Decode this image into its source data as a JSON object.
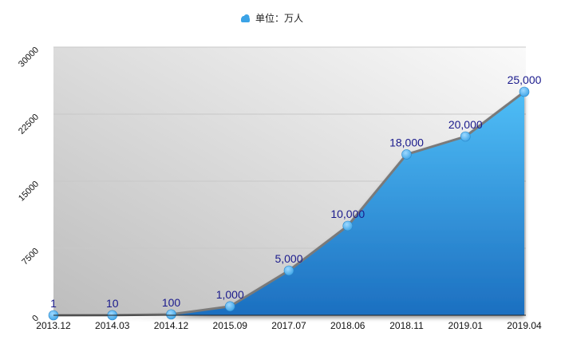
{
  "legend": {
    "label": "单位：万人",
    "icon": "cloud-icon"
  },
  "colors": {
    "area_top": "#4fbef7",
    "area_bottom": "#1c6fc0",
    "line": "#7a7a7a",
    "point": "#3ba3e6",
    "label": "#1a1a8c",
    "bg_dark": "#bdbdbd",
    "bg_light": "#fafafa",
    "grid": "#c8c8c8",
    "axis_text": "#111111"
  },
  "chart_data": {
    "type": "area",
    "categories": [
      "2013.12",
      "2014.03",
      "2014.12",
      "2015.09",
      "2017.07",
      "2018.06",
      "2018.11",
      "2019.01",
      "2019.04"
    ],
    "series": [
      {
        "name": "单位：万人",
        "values": [
          1,
          10,
          100,
          1000,
          5000,
          10000,
          18000,
          20000,
          25000
        ],
        "labels": [
          "1",
          "10",
          "100",
          "1,000",
          "5,000",
          "10,000",
          "18,000",
          "20,000",
          "25,000"
        ]
      }
    ],
    "yticks": [
      0,
      7500,
      15000,
      22500,
      30000
    ],
    "ylim": [
      0,
      30000
    ],
    "grid": true,
    "legend_position": "top-center"
  }
}
